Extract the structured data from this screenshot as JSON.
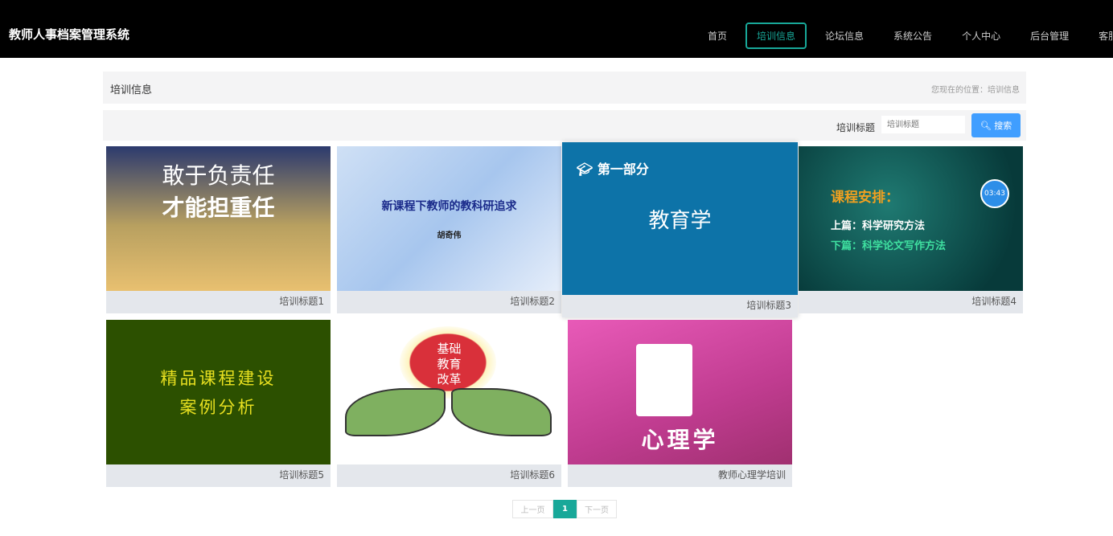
{
  "header": {
    "title": "教师人事档案管理系统",
    "nav": [
      "首页",
      "培训信息",
      "论坛信息",
      "系统公告",
      "个人中心",
      "后台管理",
      "客服"
    ],
    "active": 1,
    "accent": "#18a899"
  },
  "breadcrumb": {
    "title": "培训信息",
    "location": "您现在的位置：培训信息"
  },
  "search": {
    "label": "培训标题",
    "placeholder": "培训标题",
    "button": "搜索"
  },
  "cards": [
    {
      "caption": "培训标题1",
      "image_text": [
        "敢于负责任",
        "才能担重任"
      ]
    },
    {
      "caption": "培训标题2",
      "image_text": [
        "新课程下教师的教科研追求",
        "胡奇伟"
      ]
    },
    {
      "caption": "培训标题3",
      "image_text": [
        "第一部分",
        "教育学"
      ]
    },
    {
      "caption": "培训标题4",
      "image_text": [
        "课程安排：",
        "上篇：科学研究方法",
        "下篇：科学论文写作方法",
        "03:43"
      ]
    },
    {
      "caption": "培训标题5",
      "image_text": [
        "精品课程建设",
        "案例分析"
      ]
    },
    {
      "caption": "培训标题6",
      "image_text": [
        "基础",
        "教育",
        "改革"
      ]
    },
    {
      "caption": "教师心理学培训",
      "image_text": [
        "心理学"
      ]
    }
  ],
  "pagination": {
    "prev": "上一页",
    "current": "1",
    "next": "下一页"
  }
}
